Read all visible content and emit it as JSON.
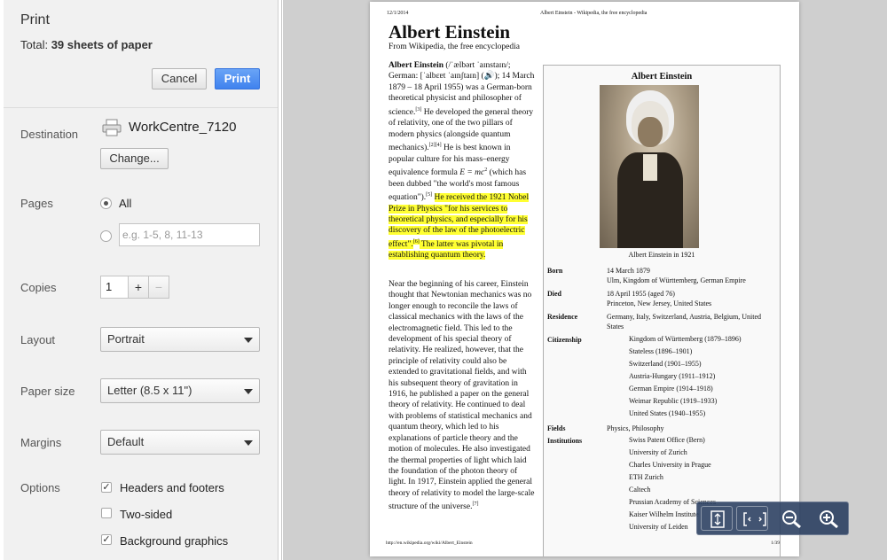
{
  "sidebar": {
    "title": "Print",
    "total_label": "Total:",
    "total_value": "39 sheets of paper",
    "cancel_label": "Cancel",
    "print_label": "Print",
    "destination_label": "Destination",
    "destination_name": "WorkCentre_7120",
    "change_label": "Change...",
    "pages_label": "Pages",
    "pages_all": "All",
    "pages_placeholder": "e.g. 1-5, 8, 11-13",
    "copies_label": "Copies",
    "copies_value": "1",
    "copies_plus": "+",
    "copies_minus": "−",
    "layout_label": "Layout",
    "layout_value": "Portrait",
    "paper_size_label": "Paper size",
    "paper_size_value": "Letter (8.5 x 11\")",
    "margins_label": "Margins",
    "margins_value": "Default",
    "options_label": "Options",
    "opt_headers": "Headers and footers",
    "opt_two_sided": "Two-sided",
    "opt_background": "Background graphics",
    "opt_headers_checked": true,
    "opt_two_sided_checked": false,
    "opt_background_checked": true
  },
  "preview": {
    "header_date": "12/1/2014",
    "header_title": "Albert Einstein - Wikipedia, the free encyclopedia",
    "article_title": "Albert Einstein",
    "article_sub": "From Wikipedia, the free encyclopedia",
    "p1_a": "Albert Einstein",
    "p1_b": " (/ˈælbərt ˈaɪnstaɪn/; German: [ˈalbɛɐt ˈaɪnʃtaɪn] (🔊); 14 March 1879 – 18 April 1955) was a German-born theoretical physicist and philosopher of science.",
    "p1_c": " He developed the general theory of relativity, one of the two pillars of modern physics (alongside quantum mechanics).",
    "p1_d": " He is best known in popular culture for his mass–energy equivalence formula ",
    "p1_formula": "E = mc",
    "p1_e": " (which has been dubbed \"the world's most famous equation\").",
    "p1_hl": "He received the 1921 Nobel Prize in Physics \"for his services to theoretical physics, and especially for his discovery of the law of the photoelectric effect\".",
    "p1_hl2": " The latter was pivotal in establishing quantum theory.",
    "p2": "Near the beginning of his career, Einstein thought that Newtonian mechanics was no longer enough to reconcile the laws of classical mechanics with the laws of the electromagnetic field. This led to the development of his special theory of relativity. He realized, however, that the principle of relativity could also be extended to gravitational fields, and with his subsequent theory of gravitation in 1916, he published a paper on the general theory of relativity. He continued to deal with problems of statistical mechanics and quantum theory, which led to his explanations of particle theory and the motion of molecules. He also investigated the thermal properties of light which laid the foundation of the photon theory of light. In 1917, Einstein applied the general theory of relativity to model the large-scale structure of the universe.",
    "infobox_title": "Albert Einstein",
    "caption": "Albert Einstein in 1921",
    "born_k": "Born",
    "born_v": "14 March 1879\nUlm, Kingdom of Württemberg, German Empire",
    "died_k": "Died",
    "died_v": "18 April 1955 (aged 76)\nPrinceton, New Jersey, United States",
    "res_k": "Residence",
    "res_v": "Germany, Italy, Switzerland, Austria, Belgium, United States",
    "cit_k": "Citizenship",
    "citizenship": [
      "Kingdom of Württemberg (1879–1896)",
      "Stateless (1896–1901)",
      "Switzerland (1901–1955)",
      "Austria-Hungary (1911–1912)",
      "German Empire (1914–1918)",
      "Weimar Republic (1919–1933)",
      "United States (1940–1955)"
    ],
    "fields_k": "Fields",
    "fields_v": "Physics, Philosophy",
    "inst_k": "Institutions",
    "institutions": [
      "Swiss Patent Office (Bern)",
      "University of Zurich",
      "Charles University in Prague",
      "ETH Zurich",
      "Caltech",
      "Prussian Academy of Sciences",
      "Kaiser Wilhelm Institute",
      "University of Leiden"
    ],
    "footer_url": "http://en.wikipedia.org/wiki/Albert_Einstein",
    "footer_page": "1/39"
  },
  "icons": [
    "printer-icon",
    "fit-to-page-icon",
    "fit-width-icon",
    "zoom-out-icon",
    "zoom-in-icon"
  ]
}
